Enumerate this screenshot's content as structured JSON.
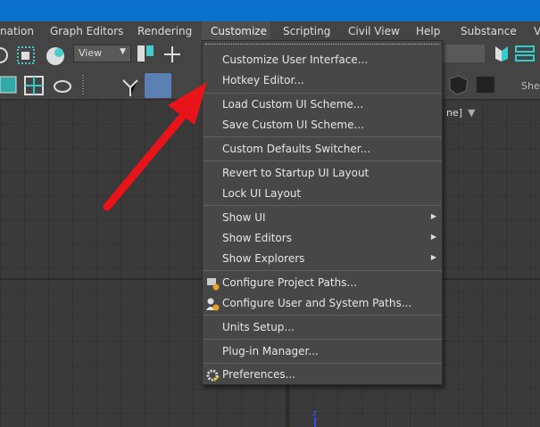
{
  "menubar": {
    "items": [
      "nation",
      "Graph Editors",
      "Rendering",
      "Customize",
      "Scripting",
      "Civil View",
      "Help",
      "Substance",
      "V"
    ],
    "active": "Customize"
  },
  "toolbar": {
    "view_dropdown": "View",
    "shelf_label": "Shel"
  },
  "viewport": {
    "label": "ne]",
    "axis_label": "z"
  },
  "customize_menu": {
    "items": [
      {
        "label": "Customize User Interface..."
      },
      {
        "label": "Hotkey Editor..."
      },
      {
        "label": "Load Custom UI Scheme..."
      },
      {
        "label": "Save Custom UI Scheme..."
      },
      {
        "label": "Custom Defaults Switcher..."
      },
      {
        "label": "Revert to Startup UI Layout"
      },
      {
        "label": "Lock UI Layout"
      },
      {
        "label": "Show UI",
        "submenu": true
      },
      {
        "label": "Show Editors",
        "submenu": true
      },
      {
        "label": "Show Explorers",
        "submenu": true
      },
      {
        "label": "Configure Project Paths...",
        "icon": "project-paths-icon"
      },
      {
        "label": "Configure User and System Paths...",
        "icon": "user-paths-icon"
      },
      {
        "label": "Units Setup..."
      },
      {
        "label": "Plug-in Manager..."
      },
      {
        "label": "Preferences...",
        "icon": "gear-icon"
      }
    ]
  },
  "colors": {
    "titlebar": "#0a72cc",
    "menu_bg": "#474747",
    "arrow": "#e8141a",
    "selected_tool": "#5b7fb3"
  }
}
